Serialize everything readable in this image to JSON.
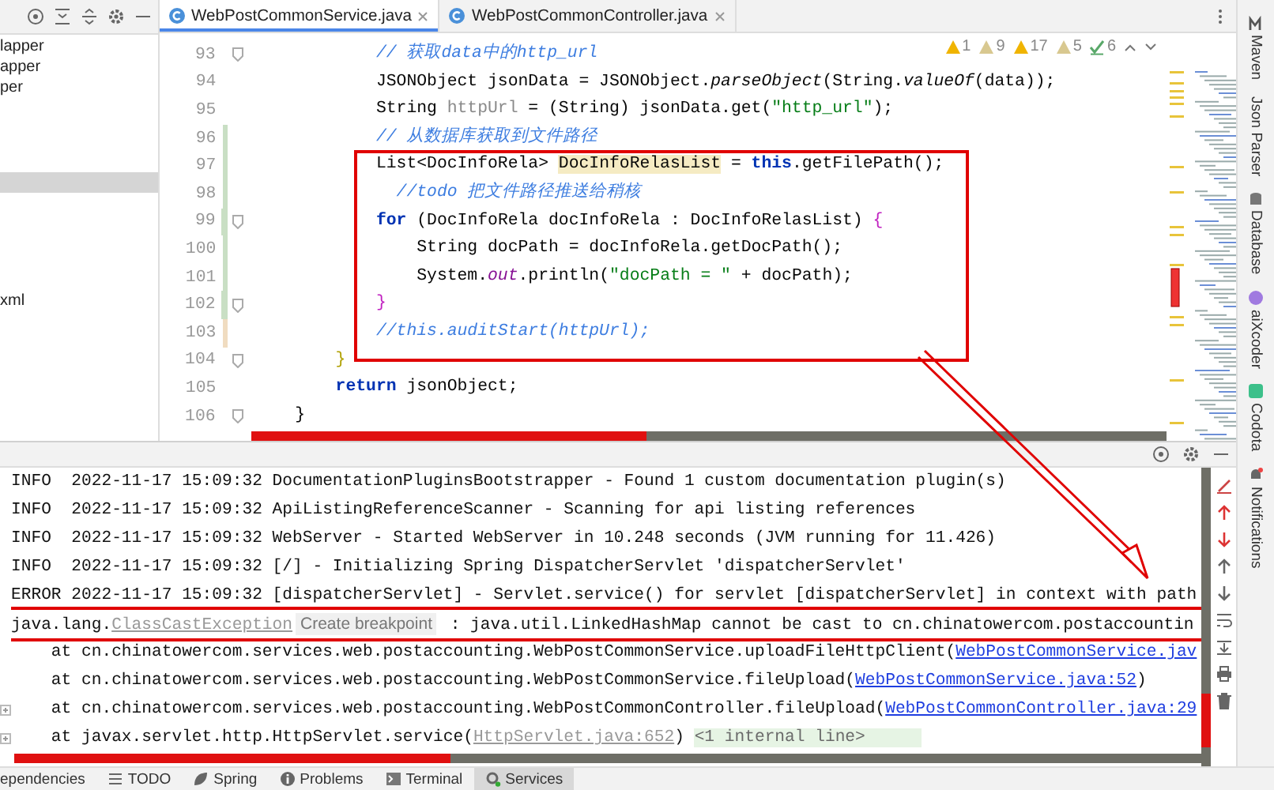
{
  "project_panel": {
    "items": [
      {
        "label": "lapper",
        "selected": false
      },
      {
        "label": "apper",
        "selected": false
      },
      {
        "label": "per",
        "selected": false
      },
      {
        "selected": true
      },
      {
        "label": "xml",
        "selected": false
      }
    ]
  },
  "tabs": [
    {
      "label": "WebPostCommonService.java",
      "selected": true
    },
    {
      "label": "WebPostCommonController.java",
      "selected": false
    }
  ],
  "inspections": [
    {
      "kind": "warning",
      "count": "1"
    },
    {
      "kind": "weak",
      "count": "9"
    },
    {
      "kind": "warning",
      "count": "17"
    },
    {
      "kind": "weak",
      "count": "5"
    },
    {
      "kind": "typo",
      "count": "6"
    }
  ],
  "editor": {
    "lines": [
      {
        "number": "93",
        "added": false,
        "modified": false,
        "fold": true,
        "tokens": [
          {
            "kind": "comment",
            "text": "            // 获取data中的http_url"
          }
        ]
      },
      {
        "number": "94",
        "added": false,
        "modified": false,
        "fold": false,
        "tokens": [
          {
            "kind": "plain",
            "text": "            JSONObject jsonData = JSONObject."
          },
          {
            "kind": "italic",
            "text": "parseObject"
          },
          {
            "kind": "plain",
            "text": "(String."
          },
          {
            "kind": "italic",
            "text": "valueOf"
          },
          {
            "kind": "plain",
            "text": "(data));"
          }
        ]
      },
      {
        "number": "95",
        "added": false,
        "modified": false,
        "fold": false,
        "tokens": [
          {
            "kind": "plain",
            "text": "            String "
          },
          {
            "kind": "muted",
            "text": "httpUrl"
          },
          {
            "kind": "plain",
            "text": " = (String) jsonData.get("
          },
          {
            "kind": "string",
            "text": "\"http_url\""
          },
          {
            "kind": "plain",
            "text": ");"
          }
        ]
      },
      {
        "number": "96",
        "added": true,
        "modified": false,
        "fold": false,
        "tokens": [
          {
            "kind": "comment",
            "text": "            // 从数据库获取到文件路径"
          }
        ]
      },
      {
        "number": "97",
        "added": true,
        "modified": false,
        "fold": false,
        "tokens": [
          {
            "kind": "plain",
            "text": "            List<DocInfoRela> "
          },
          {
            "kind": "highlight",
            "text": "DocInfoRelasList"
          },
          {
            "kind": "plain",
            "text": " = "
          },
          {
            "kind": "keyword",
            "text": "this"
          },
          {
            "kind": "plain",
            "text": ".getFilePath();"
          }
        ]
      },
      {
        "number": "98",
        "added": true,
        "modified": false,
        "fold": false,
        "tokens": [
          {
            "kind": "comment",
            "text": "              //todo 把文件路径推送给稍核"
          }
        ]
      },
      {
        "number": "99",
        "added": true,
        "modified": false,
        "fold": true,
        "tokens": [
          {
            "kind": "keyword",
            "text": "            for"
          },
          {
            "kind": "plain",
            "text": " (DocInfoRela docInfoRela : DocInfoRelasList) "
          },
          {
            "kind": "brace",
            "text": "{"
          }
        ]
      },
      {
        "number": "100",
        "added": true,
        "modified": false,
        "fold": false,
        "tokens": [
          {
            "kind": "plain",
            "text": "                String docPath = docInfoRela.getDocPath();"
          }
        ]
      },
      {
        "number": "101",
        "added": true,
        "modified": false,
        "fold": false,
        "tokens": [
          {
            "kind": "plain",
            "text": "                System."
          },
          {
            "kind": "field",
            "text": "out"
          },
          {
            "kind": "plain",
            "text": ".println("
          },
          {
            "kind": "string",
            "text": "\"docPath = \""
          },
          {
            "kind": "plain",
            "text": " + docPath);"
          }
        ]
      },
      {
        "number": "102",
        "added": true,
        "modified": false,
        "fold": true,
        "tokens": [
          {
            "kind": "brace",
            "text": "            }"
          }
        ]
      },
      {
        "number": "103",
        "added": false,
        "modified": true,
        "fold": false,
        "tokens": [
          {
            "kind": "comment",
            "text": "            //this.auditStart(httpUrl);"
          }
        ]
      },
      {
        "number": "104",
        "added": false,
        "modified": false,
        "fold": true,
        "tokens": [
          {
            "kind": "bracket",
            "text": "        }"
          }
        ]
      },
      {
        "number": "105",
        "added": false,
        "modified": false,
        "fold": false,
        "tokens": [
          {
            "kind": "keyword",
            "text": "        return"
          },
          {
            "kind": "plain",
            "text": " jsonObject;"
          }
        ]
      },
      {
        "number": "106",
        "added": false,
        "modified": false,
        "fold": true,
        "tokens": [
          {
            "kind": "plain",
            "text": "    }"
          }
        ]
      }
    ]
  },
  "right_tools": [
    "Maven",
    "Json Parser",
    "Database",
    "aiXcoder",
    "Codota",
    "Notifications"
  ],
  "console": {
    "lines": [
      {
        "fold": false,
        "segments": [
          {
            "kind": "plain",
            "text": "INFO  2022-11-17 15:09:32 DocumentationPluginsBootstrapper - Found 1 custom documentation plugin(s)"
          }
        ]
      },
      {
        "fold": false,
        "segments": [
          {
            "kind": "plain",
            "text": "INFO  2022-11-17 15:09:32 ApiListingReferenceScanner - Scanning for api listing references"
          }
        ]
      },
      {
        "fold": false,
        "segments": [
          {
            "kind": "plain",
            "text": "INFO  2022-11-17 15:09:32 WebServer - Started WebServer in 10.248 seconds (JVM running for 11.426)"
          }
        ]
      },
      {
        "fold": false,
        "segments": [
          {
            "kind": "plain",
            "text": "INFO  2022-11-17 15:09:32 [/] - Initializing Spring DispatcherServlet 'dispatcherServlet'"
          }
        ]
      },
      {
        "fold": false,
        "segments": [
          {
            "kind": "plain",
            "text": "ERROR 2022-11-17 15:09:32 [dispatcherServlet] - Servlet.service() for servlet [dispatcherServlet] in context with path"
          }
        ]
      },
      {
        "fold": false,
        "segments": [
          {
            "kind": "plain",
            "text": "java.lang."
          },
          {
            "kind": "muted",
            "text": "ClassCastException"
          },
          {
            "kind": "chip",
            "text": "Create breakpoint"
          },
          {
            "kind": "plain",
            "text": " : java.util.LinkedHashMap cannot be cast to cn.chinatowercom.postaccountin"
          }
        ]
      },
      {
        "fold": false,
        "segments": [
          {
            "kind": "plain",
            "text": "    at cn.chinatowercom.services.web.postaccounting.WebPostCommonService.uploadFileHttpClient("
          },
          {
            "kind": "link",
            "text": "WebPostCommonService.jav"
          }
        ]
      },
      {
        "fold": false,
        "segments": [
          {
            "kind": "plain",
            "text": "    at cn.chinatowercom.services.web.postaccounting.WebPostCommonService.fileUpload("
          },
          {
            "kind": "link",
            "text": "WebPostCommonService.java:52"
          },
          {
            "kind": "plain",
            "text": ")"
          }
        ]
      },
      {
        "fold": true,
        "segments": [
          {
            "kind": "plain",
            "text": "    at cn.chinatowercom.services.web.postaccounting.WebPostCommonController.fileUpload("
          },
          {
            "kind": "link",
            "text": "WebPostCommonController.java:29"
          }
        ]
      },
      {
        "fold": true,
        "segments": [
          {
            "kind": "plain",
            "text": "    at javax.servlet.http.HttpServlet.service("
          },
          {
            "kind": "muted",
            "text": "HttpServlet.java:652"
          },
          {
            "kind": "plain",
            "text": ") "
          },
          {
            "kind": "folded",
            "text": "<1 internal line>"
          }
        ]
      }
    ]
  },
  "bottom_tools": [
    {
      "label": "ependencies",
      "selected": false
    },
    {
      "label": "TODO",
      "selected": false
    },
    {
      "label": "Spring",
      "selected": false
    },
    {
      "label": "Problems",
      "selected": false
    },
    {
      "label": "Terminal",
      "selected": false
    },
    {
      "label": "Services",
      "selected": true
    }
  ]
}
